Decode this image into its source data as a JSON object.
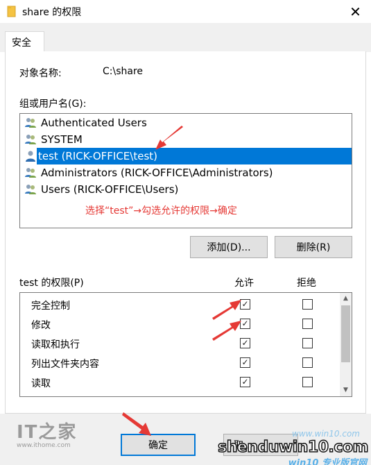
{
  "window": {
    "title": "share 的权限",
    "close_glyph": "✕"
  },
  "tabs": [
    {
      "label": "安全"
    }
  ],
  "object": {
    "label": "对象名称:",
    "value": "C:\\share"
  },
  "groups": {
    "label": "组或用户名(G):",
    "items": [
      {
        "label": "Authenticated Users",
        "selected": false,
        "icon": "user-group-icon"
      },
      {
        "label": "SYSTEM",
        "selected": false,
        "icon": "user-group-icon"
      },
      {
        "label": "test (RICK-OFFICE\\test)",
        "selected": true,
        "icon": "user-icon"
      },
      {
        "label": "Administrators (RICK-OFFICE\\Administrators)",
        "selected": false,
        "icon": "user-group-icon"
      },
      {
        "label": "Users (RICK-OFFICE\\Users)",
        "selected": false,
        "icon": "user-group-icon"
      }
    ],
    "annotation": "选择“test”→勾选允许的权限→确定"
  },
  "buttons": {
    "add": "添加(D)...",
    "remove": "删除(R)",
    "ok": "确定",
    "cancel_partial": "取"
  },
  "permissions": {
    "label": "test 的权限(P)",
    "allow_header": "允许",
    "deny_header": "拒绝",
    "check_glyph": "✓",
    "rows": [
      {
        "name": "完全控制",
        "allow": true,
        "deny": false
      },
      {
        "name": "修改",
        "allow": true,
        "deny": false
      },
      {
        "name": "读取和执行",
        "allow": true,
        "deny": false
      },
      {
        "name": "列出文件夹内容",
        "allow": true,
        "deny": false
      },
      {
        "name": "读取",
        "allow": true,
        "deny": false
      }
    ]
  },
  "watermarks": {
    "left_logo": "IT之家",
    "left_url": "www.ithome.com",
    "right_faint": "www.win10.com",
    "right_site": "shenduwin10.com",
    "right_tag": "win10 专业版官网"
  },
  "colors": {
    "selection": "#0078d7",
    "annotation": "#e53935",
    "arrow": "#e53935"
  }
}
